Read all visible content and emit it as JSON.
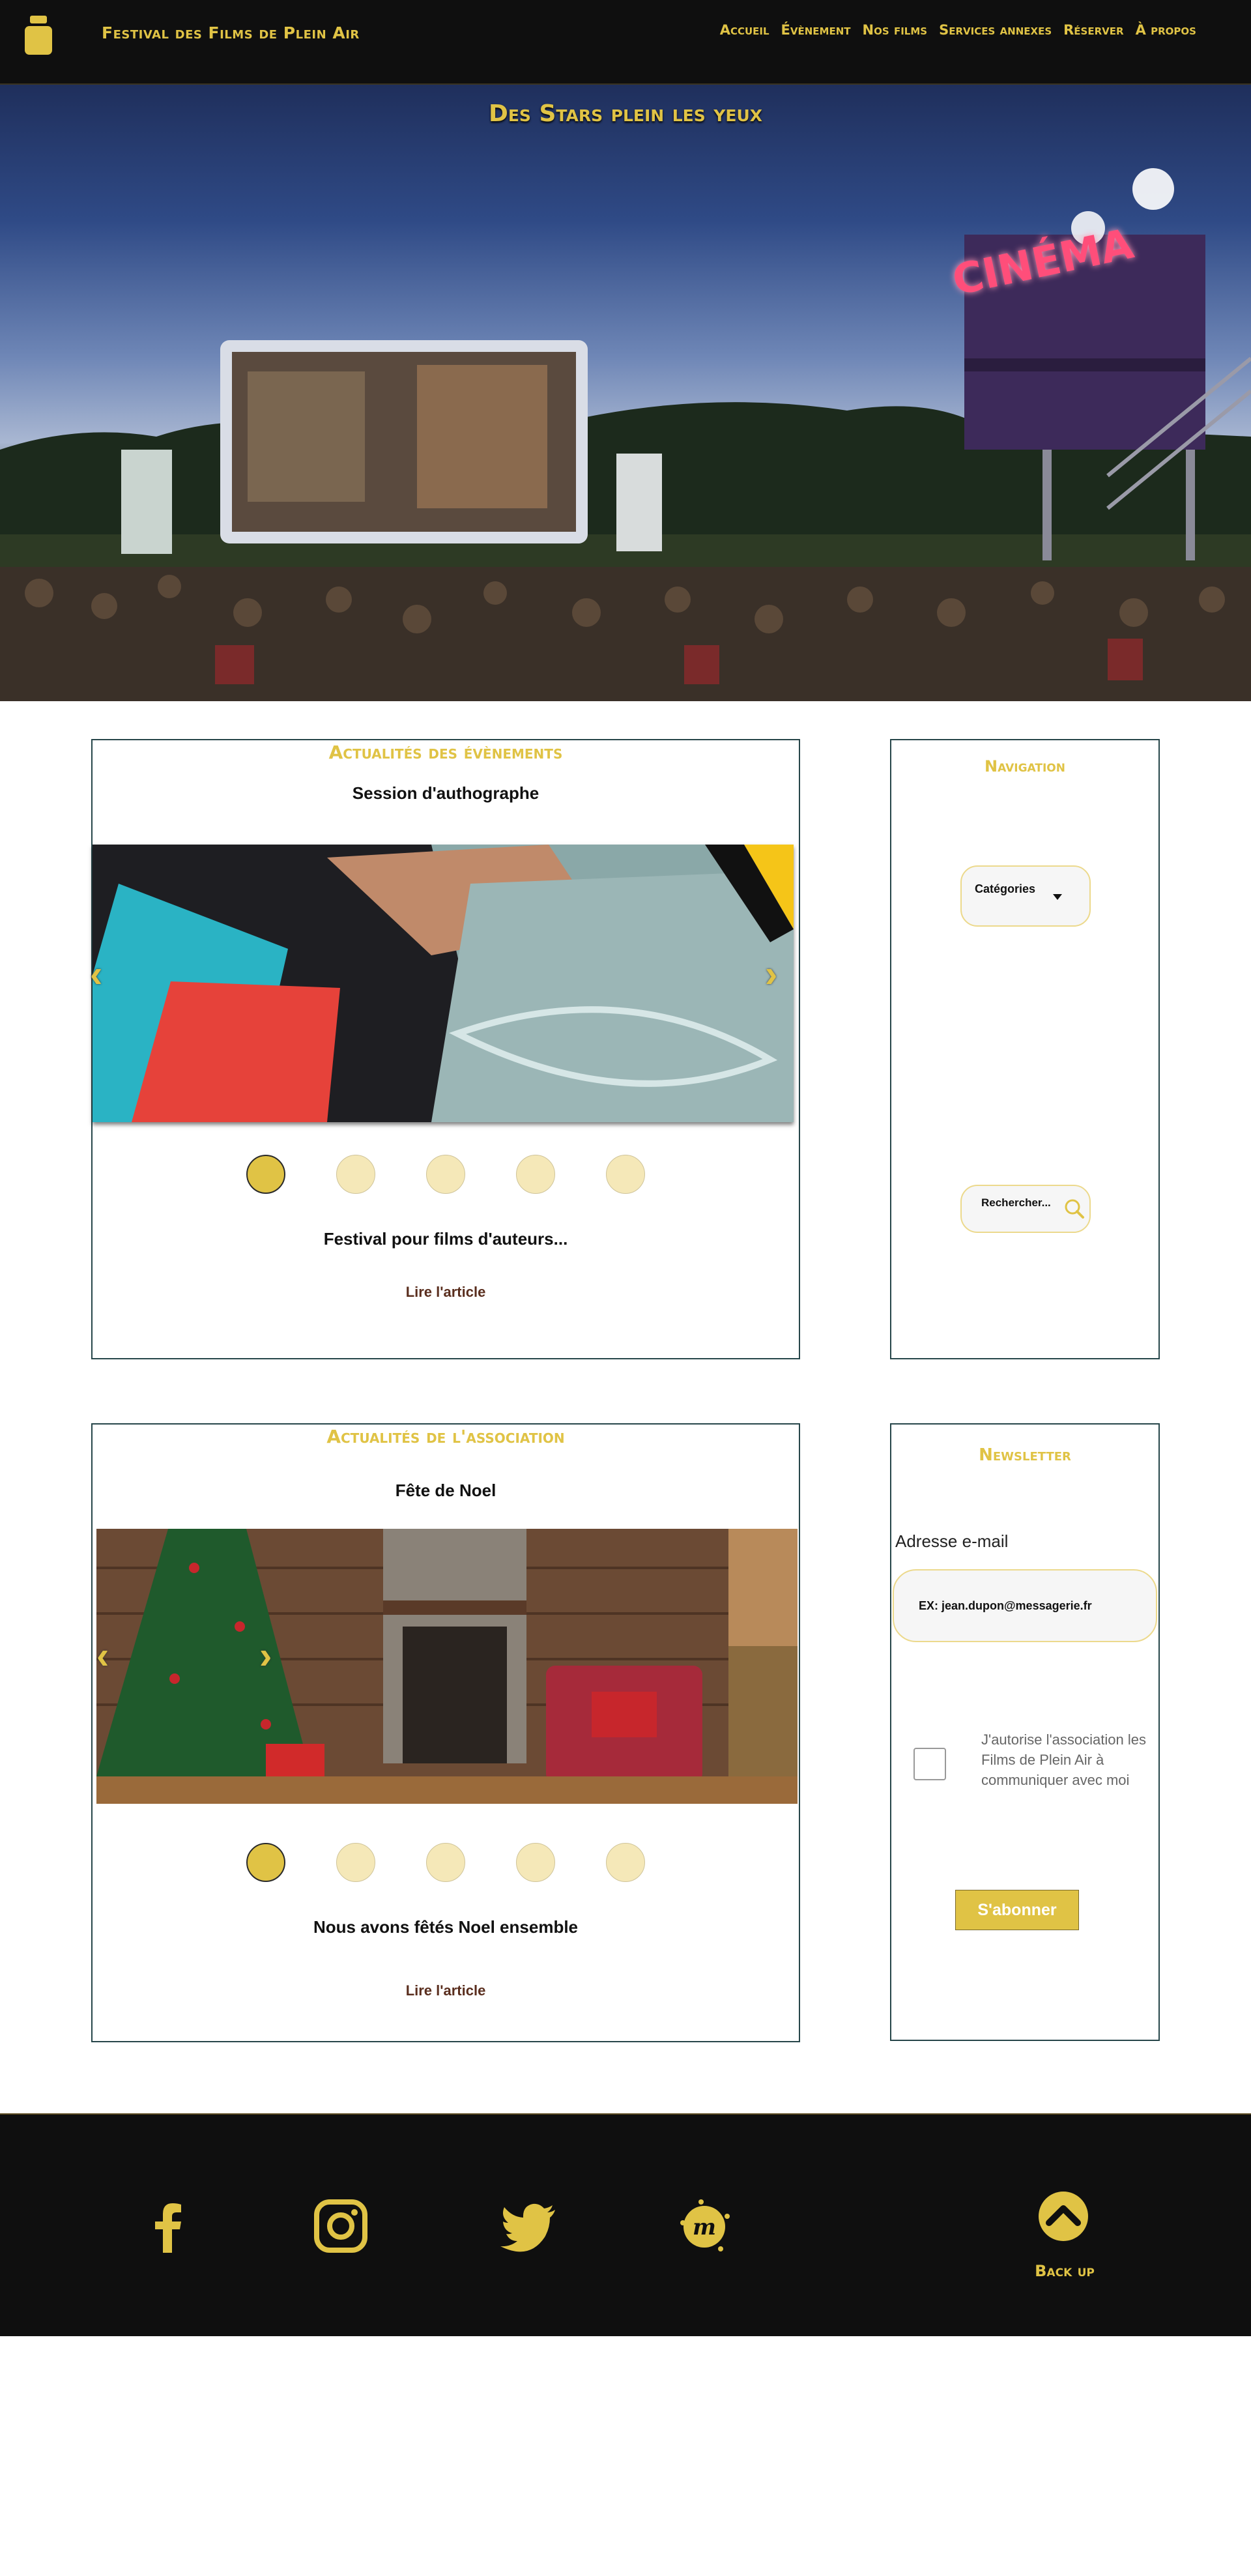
{
  "header": {
    "site_title": "Festival des Films de Plein Air",
    "nav": [
      "Accueil",
      "Évènement",
      "Nos films",
      "Services annexes",
      "Réserver",
      "À propos"
    ]
  },
  "hero": {
    "title": "Des Stars plein les yeux",
    "sign_text": "CINÉMA"
  },
  "events": {
    "title": "Actualités des évènements",
    "slide_title": "Session d'authographe",
    "caption": "Festival pour films d'auteurs...",
    "read_more": "Lire l'article",
    "dots_active": 1,
    "dots_total": 5
  },
  "sidebar": {
    "title": "Navigation",
    "categories_label": "Catégories",
    "search_placeholder": "Rechercher..."
  },
  "association": {
    "title": "Actualités de l'association",
    "slide_title": "Fête de Noel",
    "caption": "Nous avons fêtés Noel ensemble",
    "read_more": "Lire l'article",
    "dots_active": 1,
    "dots_total": 5
  },
  "newsletter": {
    "title": "Newsletter",
    "email_label": "Adresse e-mail",
    "email_placeholder": "EX: jean.dupon@messagerie.fr",
    "consent_text": "J'autorise l'association les Films de Plein Air à communiquer avec moi",
    "subscribe_label": "S'abonner"
  },
  "footer": {
    "back_up_label": "Back up",
    "social": [
      "facebook-icon",
      "instagram-icon",
      "twitter-icon",
      "meetup-icon"
    ]
  },
  "colors": {
    "accent": "#E0C345",
    "dark": "#0f0f0f",
    "border": "#27464a",
    "dot_inactive": "#f5e8b8"
  }
}
